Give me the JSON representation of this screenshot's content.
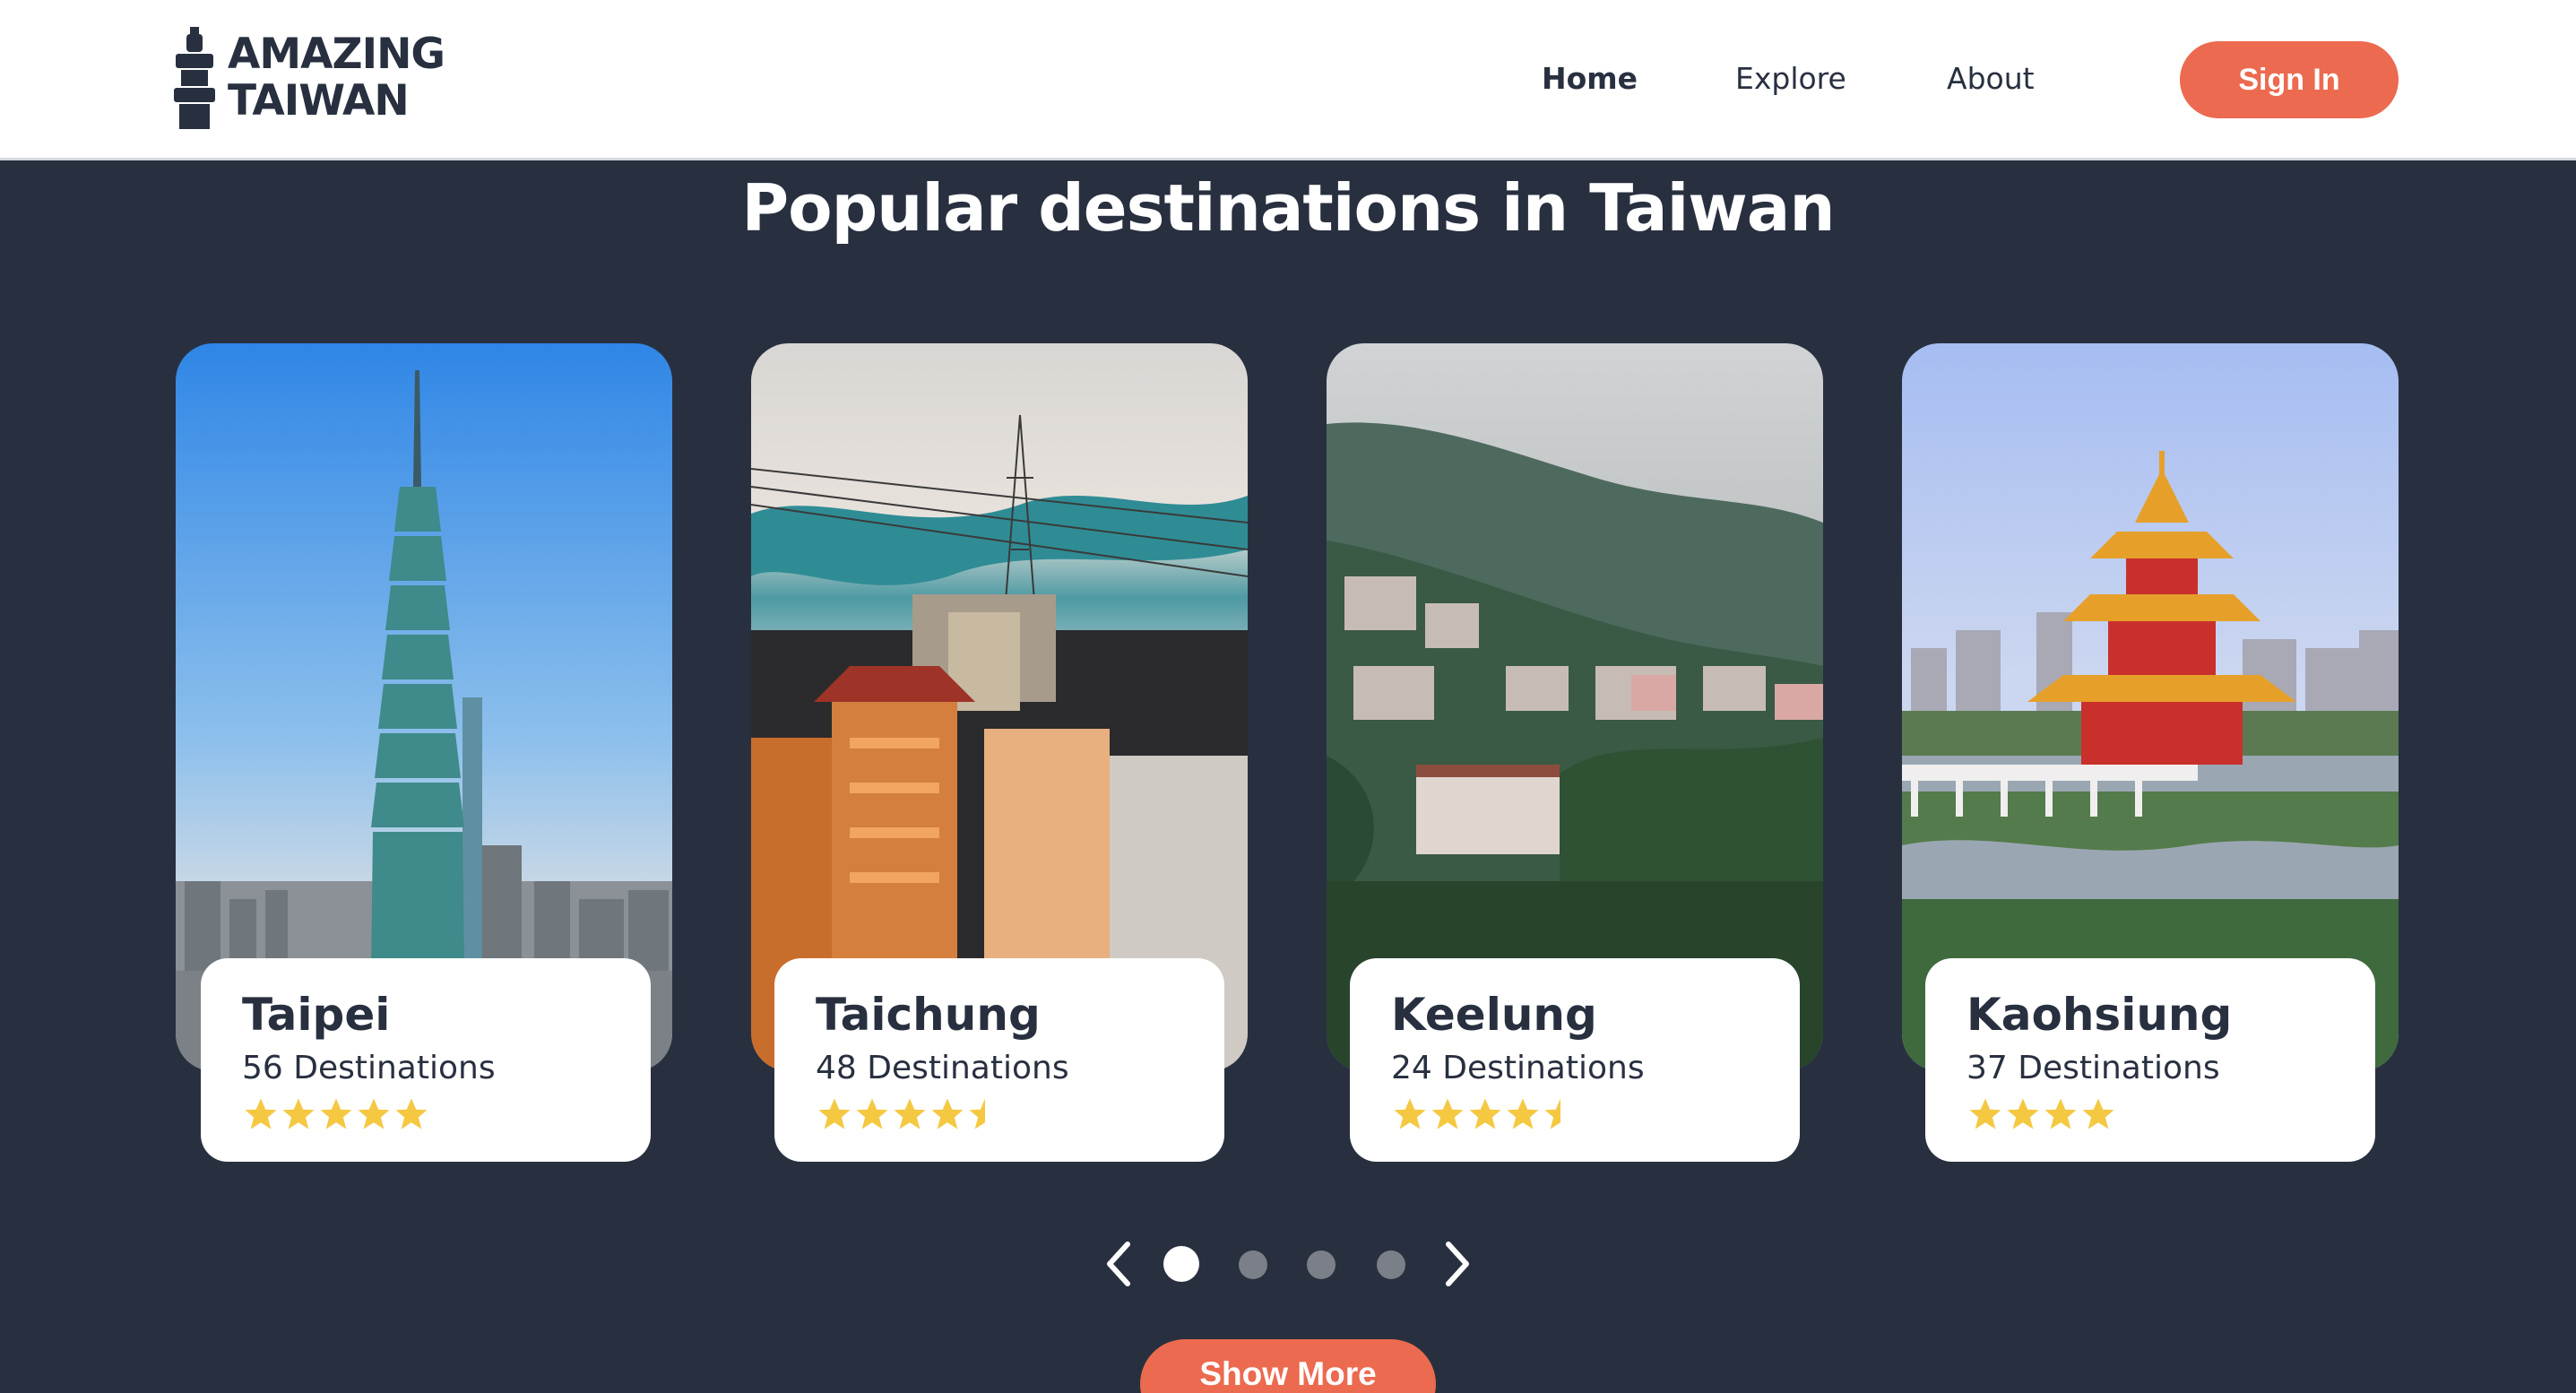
{
  "header": {
    "logo_line1": "AMAZING",
    "logo_line2": "TAIWAN",
    "nav": [
      {
        "label": "Home",
        "active": true
      },
      {
        "label": "Explore",
        "active": false
      },
      {
        "label": "About",
        "active": false
      }
    ],
    "signin_label": "Sign In"
  },
  "section": {
    "title": "Popular destinations in Taiwan"
  },
  "cards": [
    {
      "name": "Taipei",
      "count": "56 Destinations",
      "rating": 5,
      "image": "taipei-101-skyline"
    },
    {
      "name": "Taichung",
      "count": "48 Destinations",
      "rating": 4.5,
      "image": "taichung-town-power-tower"
    },
    {
      "name": "Keelung",
      "count": "24 Destinations",
      "rating": 4.5,
      "image": "keelung-hillside-houses"
    },
    {
      "name": "Kaohsiung",
      "count": "37 Destinations",
      "rating": 4,
      "image": "kaohsiung-pagoda-lake"
    }
  ],
  "carousel": {
    "page_count": 4,
    "active_page": 1
  },
  "show_more_label": "Show More",
  "colors": {
    "accent": "#ec6a4f",
    "dark": "#283040",
    "star": "#f5c842",
    "white": "#ffffff"
  }
}
